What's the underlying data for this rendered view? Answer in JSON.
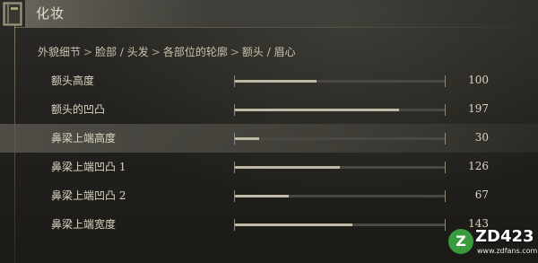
{
  "window": {
    "title": "化妆"
  },
  "breadcrumb": [
    "外貌细节",
    "脸部 / 头发",
    "各部位的轮廓",
    "额头 / 眉心"
  ],
  "breadcrumb_sep": ">",
  "sliders": [
    {
      "label": "额头高度",
      "value": "100",
      "fill_fraction": 0.39
    },
    {
      "label": "额头的凹凸",
      "value": "197",
      "fill_fraction": 0.78
    },
    {
      "label": "鼻梁上端高度",
      "value": "30",
      "fill_fraction": 0.12,
      "selected": true
    },
    {
      "label": "鼻梁上端凹凸 1",
      "value": "126",
      "fill_fraction": 0.5
    },
    {
      "label": "鼻梁上端凹凸 2",
      "value": "67",
      "fill_fraction": 0.26
    },
    {
      "label": "鼻梁上端宽度",
      "value": "143",
      "fill_fraction": 0.56
    }
  ],
  "watermark": {
    "logo": "Z",
    "text": "ZD423",
    "sub": "www.zdfans.com"
  },
  "icons": {
    "title": "book-icon"
  }
}
